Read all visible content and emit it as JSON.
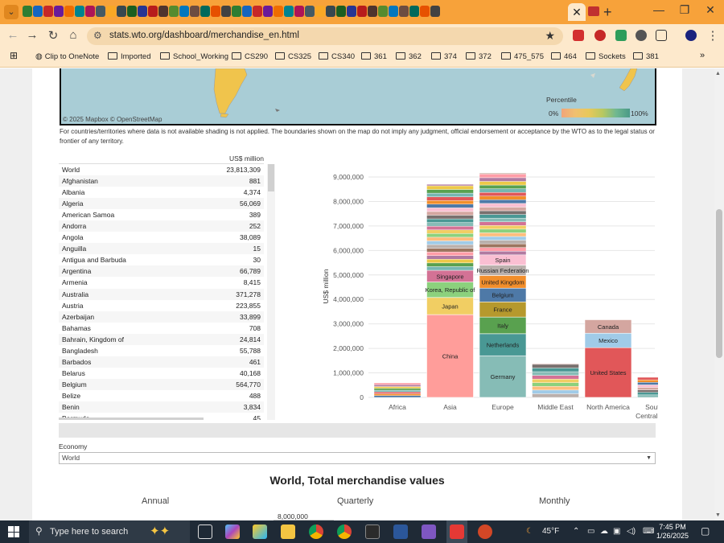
{
  "browser": {
    "url": "stats.wto.org/dashboard/merchandise_en.html",
    "bookmarks": [
      "Clip to OneNote",
      "Imported",
      "School_Working",
      "CS290",
      "CS325",
      "CS340",
      "361",
      "362",
      "374",
      "372",
      "475_575",
      "464",
      "Sockets",
      "381"
    ]
  },
  "map": {
    "attribution": "© 2025 Mapbox  © OpenStreetMap",
    "percentile_label": "Percentile",
    "pct_low": "0%",
    "pct_high": "100%",
    "note": "For countries/territories where data is not available shading is not applied. The boundaries shown on the map do not imply any judgment, official endorsement or acceptance by the WTO as to the legal status or frontier of any territory."
  },
  "table": {
    "header": "US$ million",
    "rows": [
      {
        "name": "World",
        "value": "23,813,309"
      },
      {
        "name": "Afghanistan",
        "value": "881"
      },
      {
        "name": "Albania",
        "value": "4,374"
      },
      {
        "name": "Algeria",
        "value": "56,069"
      },
      {
        "name": "American Samoa",
        "value": "389"
      },
      {
        "name": "Andorra",
        "value": "252"
      },
      {
        "name": "Angola",
        "value": "38,089"
      },
      {
        "name": "Anguilla",
        "value": "15"
      },
      {
        "name": "Antigua and Barbuda",
        "value": "30"
      },
      {
        "name": "Argentina",
        "value": "66,789"
      },
      {
        "name": "Armenia",
        "value": "8,415"
      },
      {
        "name": "Australia",
        "value": "371,278"
      },
      {
        "name": "Austria",
        "value": "223,855"
      },
      {
        "name": "Azerbaijan",
        "value": "33,899"
      },
      {
        "name": "Bahamas",
        "value": "708"
      },
      {
        "name": "Bahrain, Kingdom of",
        "value": "24,814"
      },
      {
        "name": "Bangladesh",
        "value": "55,788"
      },
      {
        "name": "Barbados",
        "value": "461"
      },
      {
        "name": "Belarus",
        "value": "40,168"
      },
      {
        "name": "Belgium",
        "value": "564,770"
      },
      {
        "name": "Belize",
        "value": "488"
      },
      {
        "name": "Benin",
        "value": "3,834"
      },
      {
        "name": "Bermuda",
        "value": "45"
      }
    ]
  },
  "chart_data": {
    "type": "bar",
    "ylabel": "US$ million",
    "ylim": [
      0,
      9000000
    ],
    "yticks": [
      "0",
      "1,000,000",
      "2,000,000",
      "3,000,000",
      "4,000,000",
      "5,000,000",
      "6,000,000",
      "7,000,000",
      "8,000,000",
      "9,000,000"
    ],
    "categories": [
      "Africa",
      "Asia",
      "Europe",
      "Middle East",
      "North America",
      "South and Central Americ..."
    ],
    "totals": [
      590000,
      8700000,
      9150000,
      1380000,
      3170000,
      820000
    ],
    "segments": {
      "Asia": [
        {
          "name": "China",
          "value": 3380000,
          "color": "#ff9d9a"
        },
        {
          "name": "Japan",
          "value": 700000,
          "color": "#f1ce63"
        },
        {
          "name": "Korea, Republic of",
          "value": 630000,
          "color": "#8cd17d"
        },
        {
          "name": "Singapore",
          "value": 480000,
          "color": "#d37295"
        }
      ],
      "Europe": [
        {
          "name": "Germany",
          "value": 1700000,
          "color": "#86bcb6"
        },
        {
          "name": "Netherlands",
          "value": 900000,
          "color": "#499894"
        },
        {
          "name": "Italy",
          "value": 680000,
          "color": "#59a14f"
        },
        {
          "name": "France",
          "value": 620000,
          "color": "#b6992d"
        },
        {
          "name": "Belgium",
          "value": 560000,
          "color": "#4e79a7"
        },
        {
          "name": "United Kingdom",
          "value": 520000,
          "color": "#f28e2b"
        },
        {
          "name": "Russian Federation",
          "value": 420000,
          "color": "#bab0ac"
        },
        {
          "name": "Spain",
          "value": 420000,
          "color": "#fabfd2"
        }
      ],
      "North America": [
        {
          "name": "United States",
          "value": 2030000,
          "color": "#e15759"
        },
        {
          "name": "Mexico",
          "value": 590000,
          "color": "#a0cbe8"
        },
        {
          "name": "Canada",
          "value": 550000,
          "color": "#d4a6a0"
        }
      ]
    },
    "colors": {
      "accent": "#e15759",
      "grid": "#e6e6e6"
    }
  },
  "controls": {
    "economy_label": "Economy",
    "economy_value": "World",
    "section_title": "World,  Total merchandise values",
    "tabs": [
      "Annual",
      "Quarterly",
      "Monthly"
    ],
    "mini_axis_label": "8,000,000"
  },
  "taskbar": {
    "search_placeholder": "Type here to search",
    "weather": "45°F",
    "time": "7:45 PM",
    "date": "1/26/2025"
  }
}
